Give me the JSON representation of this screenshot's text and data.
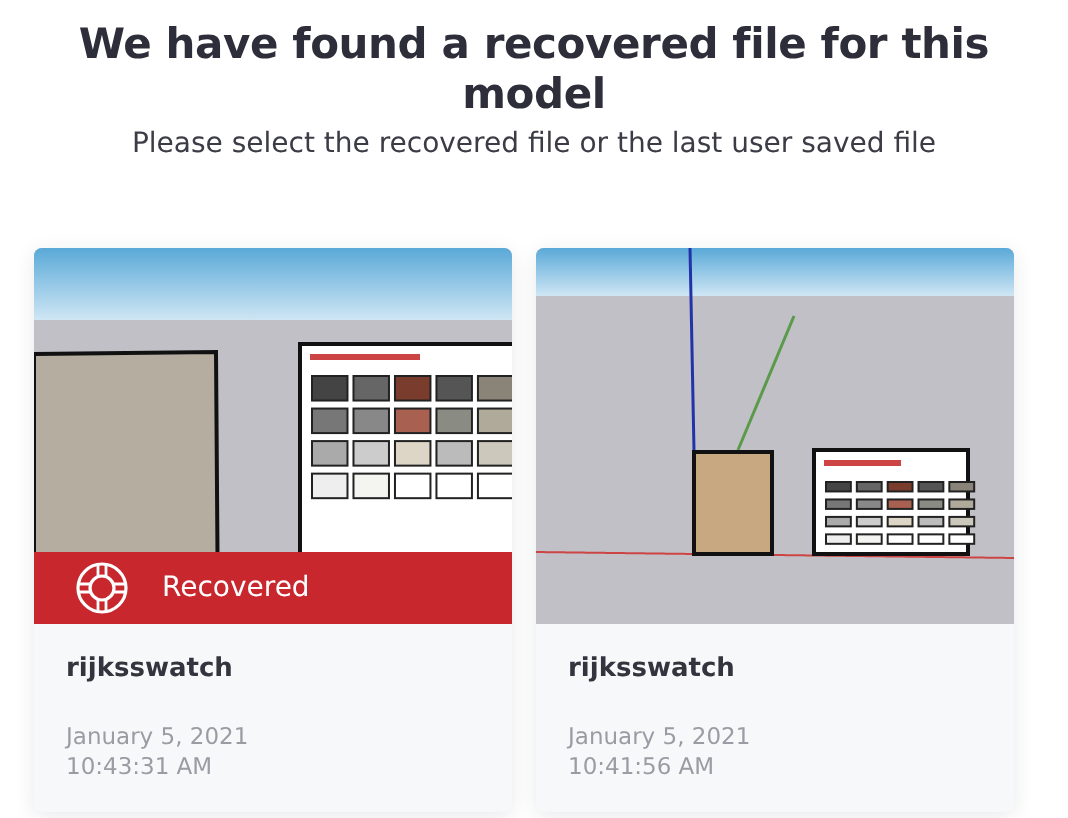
{
  "title": "We have found a recovered file for this model",
  "subtitle": "Please select the recovered file or the last user saved file",
  "files": [
    {
      "name": "rijksswatch",
      "date": "January 5, 2021",
      "time": "10:43:31 AM",
      "recovered": true,
      "badge": "Recovered"
    },
    {
      "name": "rijksswatch",
      "date": "January 5, 2021",
      "time": "10:41:56 AM",
      "recovered": false
    }
  ]
}
